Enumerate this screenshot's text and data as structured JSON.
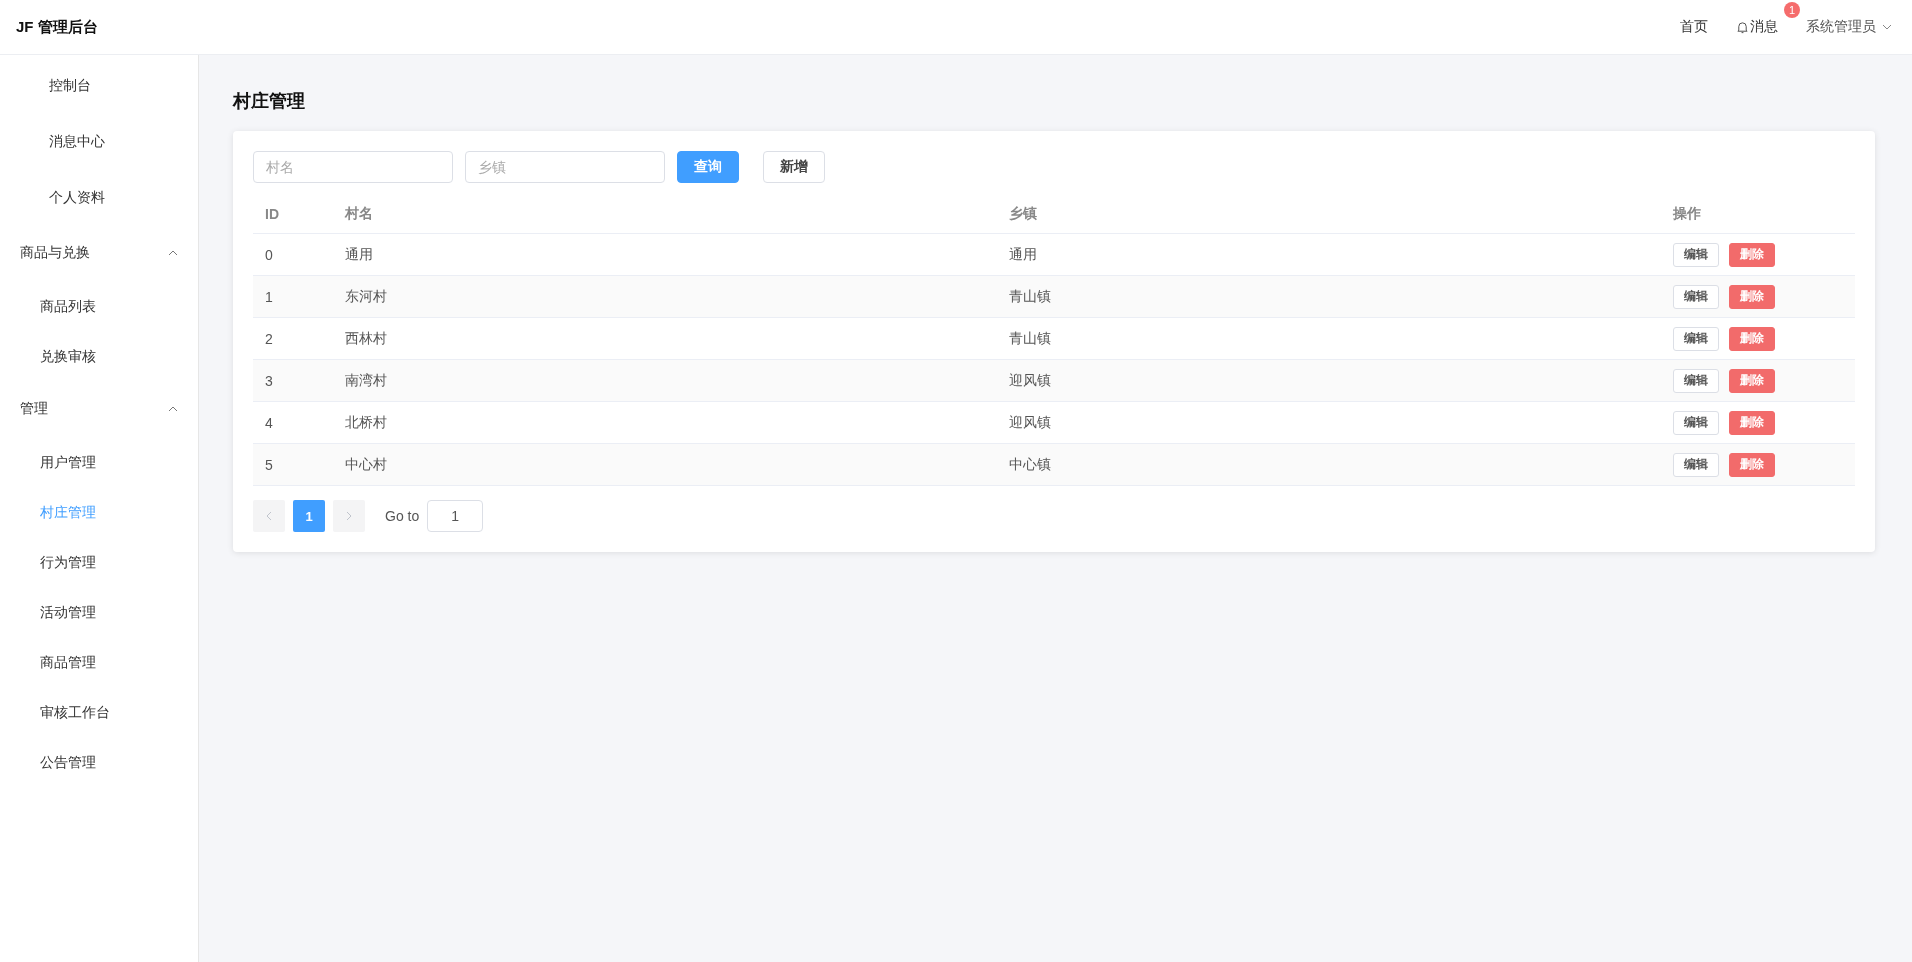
{
  "app": {
    "title": "JF 管理后台"
  },
  "header": {
    "links": [
      {
        "kind": "link",
        "label": "首页"
      },
      {
        "kind": "messages",
        "label": "消息",
        "badge": "1"
      }
    ],
    "user": {
      "name": "系统管理员"
    }
  },
  "sidebar": {
    "items": [
      {
        "label": "控制台",
        "selected": false
      },
      {
        "label": "消息中心",
        "selected": false
      },
      {
        "label": "个人资料",
        "selected": false
      },
      {
        "label": "商品与兑换",
        "expanded": true,
        "children": [
          {
            "label": "商品列表",
            "selected": false
          },
          {
            "label": "兑换审核",
            "selected": false
          }
        ]
      },
      {
        "label": "管理",
        "expanded": true,
        "children": [
          {
            "label": "用户管理",
            "selected": false
          },
          {
            "label": "村庄管理",
            "selected": true
          },
          {
            "label": "行为管理",
            "selected": false
          },
          {
            "label": "活动管理",
            "selected": false
          },
          {
            "label": "商品管理",
            "selected": false
          },
          {
            "label": "审核工作台",
            "selected": false
          },
          {
            "label": "公告管理",
            "selected": false
          }
        ]
      }
    ]
  },
  "page": {
    "title": "村庄管理"
  },
  "filters": [
    {
      "placeholder": "村名"
    },
    {
      "placeholder": "乡镇"
    }
  ],
  "buttons": [
    {
      "kind": "primary",
      "label": "查询"
    },
    {
      "kind": "default",
      "label": "新增"
    }
  ],
  "table": {
    "columns": [
      "ID",
      "村名",
      "乡镇",
      "操作"
    ],
    "rows": [
      {
        "id": "0",
        "village": "通用",
        "town": "通用",
        "actions": [
          {
            "kind": "default",
            "label": "编辑"
          },
          {
            "kind": "danger",
            "label": "删除"
          }
        ]
      },
      {
        "id": "1",
        "village": "东河村",
        "town": "青山镇",
        "actions": [
          {
            "kind": "default",
            "label": "编辑"
          },
          {
            "kind": "danger",
            "label": "删除"
          }
        ]
      },
      {
        "id": "2",
        "village": "西林村",
        "town": "青山镇",
        "actions": [
          {
            "kind": "default",
            "label": "编辑"
          },
          {
            "kind": "danger",
            "label": "删除"
          }
        ]
      },
      {
        "id": "3",
        "village": "南湾村",
        "town": "迎风镇",
        "actions": [
          {
            "kind": "default",
            "label": "编辑"
          },
          {
            "kind": "danger",
            "label": "删除"
          }
        ]
      },
      {
        "id": "4",
        "village": "北桥村",
        "town": "迎风镇",
        "actions": [
          {
            "kind": "default",
            "label": "编辑"
          },
          {
            "kind": "danger",
            "label": "删除"
          }
        ]
      },
      {
        "id": "5",
        "village": "中心村",
        "town": "中心镇",
        "actions": [
          {
            "kind": "default",
            "label": "编辑"
          },
          {
            "kind": "danger",
            "label": "删除"
          }
        ]
      }
    ]
  },
  "pagination": {
    "prev_disabled": true,
    "next_disabled": true,
    "pages": [
      {
        "label": "1",
        "selected": true
      }
    ],
    "goto_label": "Go to",
    "goto_value": "1"
  }
}
